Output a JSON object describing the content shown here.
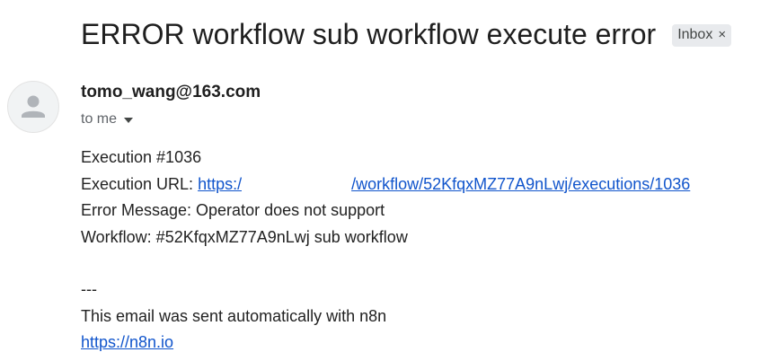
{
  "email": {
    "subject": "ERROR workflow sub workflow execute error",
    "label": {
      "name": "Inbox",
      "remove_glyph": "×"
    },
    "sender": "tomo_wang@163.com",
    "recipient": "to me",
    "avatar_icon": "person-icon",
    "body": {
      "execution_line": "Execution #1036",
      "url_label": "Execution URL: ",
      "url_prefix": "https:/",
      "url_suffix": "/workflow/52KfqxMZ77A9nLwj/executions/1036",
      "error_line": "Error Message: Operator does not support",
      "workflow_line": "Workflow: #52KfqxMZ77A9nLwj sub workflow",
      "separator": "---",
      "footer_text": "This email was sent automatically with n8n",
      "footer_link": "https://n8n.io"
    }
  },
  "colors": {
    "link": "#1155cc",
    "chip_background": "#e8eaed",
    "secondary_text": "#5f6368"
  }
}
